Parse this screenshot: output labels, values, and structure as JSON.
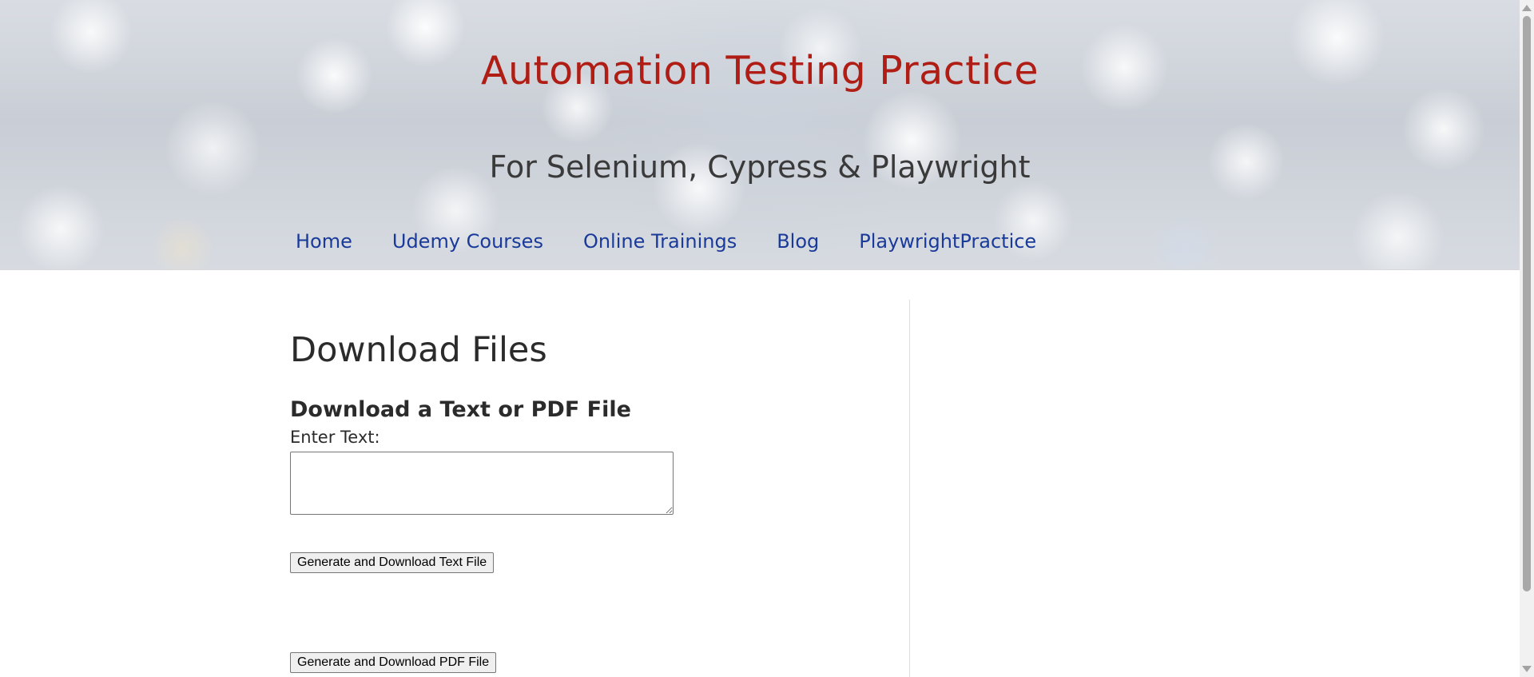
{
  "header": {
    "title": "Automation Testing Practice",
    "subtitle": "For Selenium, Cypress & Playwright",
    "nav": [
      {
        "label": "Home"
      },
      {
        "label": "Udemy Courses"
      },
      {
        "label": "Online Trainings"
      },
      {
        "label": "Blog"
      },
      {
        "label": "PlaywrightPractice"
      }
    ]
  },
  "main": {
    "page_title": "Download Files",
    "section_heading": "Download a Text or PDF File",
    "input_label": "Enter Text:",
    "input_value": "",
    "text_button": "Generate and Download Text File",
    "pdf_button": "Generate and Download PDF File"
  },
  "colors": {
    "title": "#b01d14",
    "nav_link": "#1a3a9a",
    "text": "#2b2b2b"
  }
}
